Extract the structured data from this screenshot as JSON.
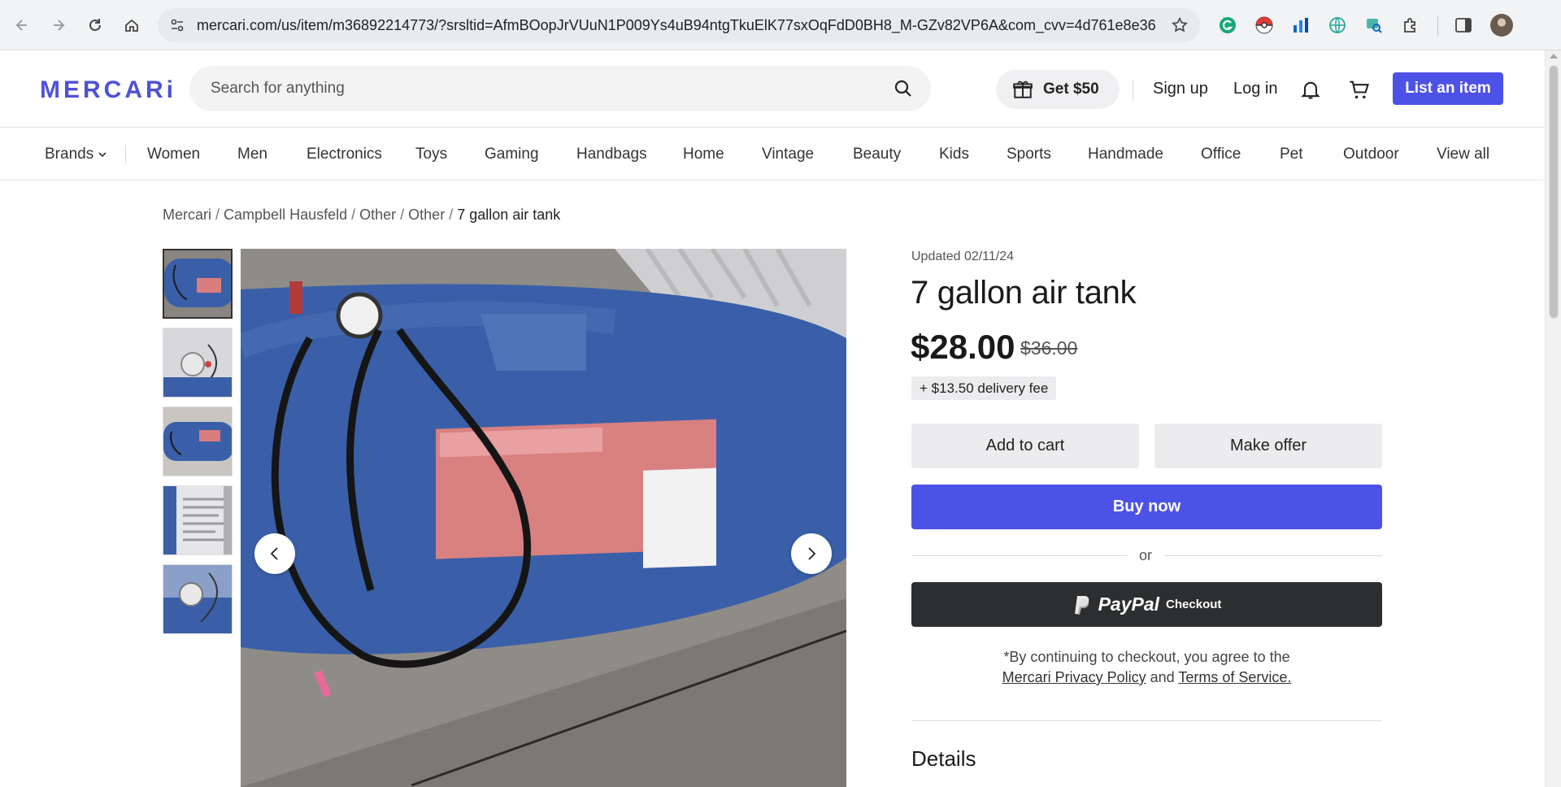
{
  "browser": {
    "url": "mercari.com/us/item/m36892214773/?srsltid=AfmBOopJrVUuN1P009Ys4uB94ntgTkuElK77sxOqFdD0BH8_M-GZv82VP6A&com_cvv=4d761e8e36d2c524..."
  },
  "header": {
    "logo": "MERCARi",
    "search_placeholder": "Search for anything",
    "promo_label": "Get $50",
    "sign_up": "Sign up",
    "log_in": "Log in",
    "list_item": "List an item"
  },
  "categories": [
    "Brands",
    "Women",
    "Men",
    "Electronics",
    "Toys",
    "Gaming",
    "Handbags",
    "Home",
    "Vintage",
    "Beauty",
    "Kids",
    "Sports",
    "Handmade",
    "Office",
    "Pet",
    "Outdoor",
    "View all"
  ],
  "breadcrumb": {
    "items": [
      "Mercari",
      "Campbell Hausfeld",
      "Other",
      "Other"
    ],
    "current": "7 gallon air tank"
  },
  "product": {
    "updated": "Updated 02/11/24",
    "title": "7 gallon air tank",
    "price": "$28.00",
    "original_price": "$36.00",
    "delivery_fee": "+ $13.50 delivery fee",
    "add_to_cart": "Add to cart",
    "make_offer": "Make offer",
    "buy_now": "Buy now",
    "or": "or",
    "paypal_word": "PayPal",
    "paypal_checkout": "Checkout",
    "terms_prefix": "*By continuing to checkout, you agree to the",
    "privacy_link": "Mercari Privacy Policy",
    "terms_and": "and",
    "terms_link": "Terms of Service.",
    "details_heading": "Details"
  },
  "colors": {
    "brand": "#4d52e6",
    "paypal_bg": "#2c2e2f",
    "tank_blue": "#3a5fa8"
  }
}
